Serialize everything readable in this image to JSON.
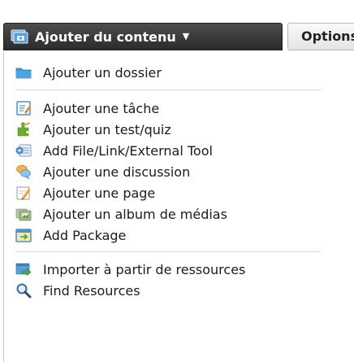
{
  "toolbar": {
    "add_content_label": "Ajouter du contenu",
    "options_label": "Options"
  },
  "menu": {
    "items": [
      {
        "label": "Ajouter un dossier",
        "icon": "folder-icon"
      },
      {
        "label": "Ajouter une tâche",
        "icon": "assignment-icon"
      },
      {
        "label": "Ajouter un test/quiz",
        "icon": "quiz-puzzle-icon"
      },
      {
        "label": "Add File/Link/External Tool",
        "icon": "file-link-icon"
      },
      {
        "label": "Ajouter une discussion",
        "icon": "discussion-bubbles-icon"
      },
      {
        "label": "Ajouter une page",
        "icon": "page-edit-icon"
      },
      {
        "label": "Ajouter un album de médias",
        "icon": "media-album-icon"
      },
      {
        "label": "Add Package",
        "icon": "package-icon"
      },
      {
        "label": "Importer à partir de ressources",
        "icon": "import-resources-icon"
      },
      {
        "label": "Find Resources",
        "icon": "magnifier-icon"
      }
    ]
  },
  "colors": {
    "add_button_bg": "#3a3a3a",
    "options_button_bg": "#eeeeee",
    "divider": "#d7d7d7",
    "folder_blue": "#3f9ad6"
  }
}
